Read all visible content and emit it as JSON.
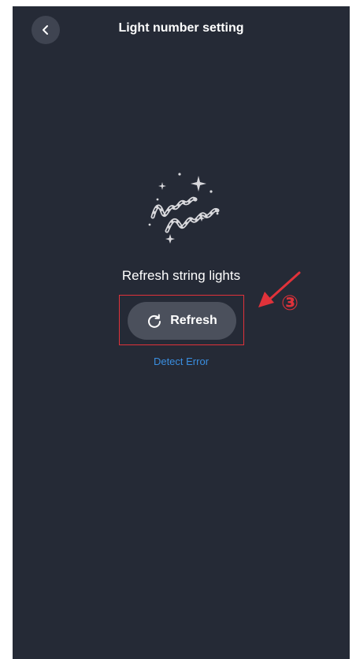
{
  "header": {
    "title": "Light number setting",
    "back_icon": "chevron-left-icon"
  },
  "main": {
    "illustration_icon": "string-lights-sparkle-icon",
    "headline": "Refresh string lights",
    "refresh_button": {
      "label": "Refresh",
      "icon": "refresh-icon"
    },
    "detect_error_link": "Detect Error"
  },
  "annotation": {
    "step_number": "③",
    "color": "#e0323a"
  },
  "colors": {
    "background": "#252a36",
    "button": "#4b505c",
    "link": "#3a8ee0"
  }
}
